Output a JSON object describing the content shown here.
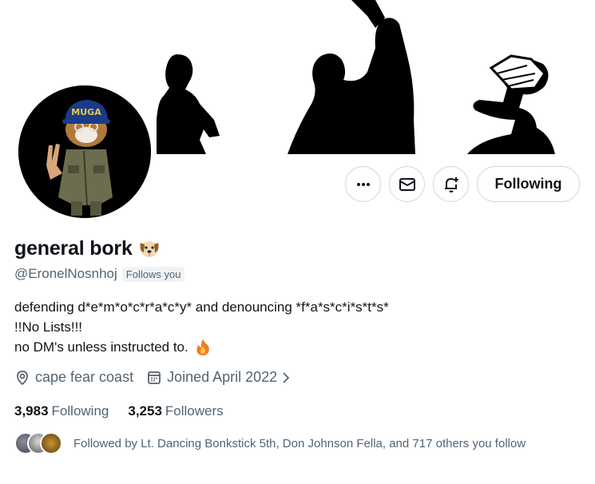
{
  "profile": {
    "display_name": "general bork",
    "handle": "@EronelNosnhoj",
    "follows_you_label": "Follows you",
    "avatar_cap_text": "MUGA",
    "bio_lines": [
      "defending d*e*m*o*c*r*a*c*y* and denouncing *f*a*s*c*i*s*t*s*",
      "!!No Lists!!!",
      "no DM's unless instructed to."
    ],
    "location": "cape fear coast",
    "joined": "Joined April 2022"
  },
  "actions": {
    "more_icon": "more-icon",
    "message_icon": "mail-icon",
    "notify_icon": "bell-plus-icon",
    "follow_label": "Following"
  },
  "stats": {
    "following_count": "3,983",
    "following_label": "Following",
    "followers_count": "3,253",
    "followers_label": "Followers"
  },
  "followed_by": {
    "text": "Followed by Lt. Dancing Bonkstick 5th, Don Johnson Fella, and 717 others you follow"
  },
  "colors": {
    "text": "#0f1419",
    "muted": "#536471",
    "border": "#cfd9de"
  }
}
